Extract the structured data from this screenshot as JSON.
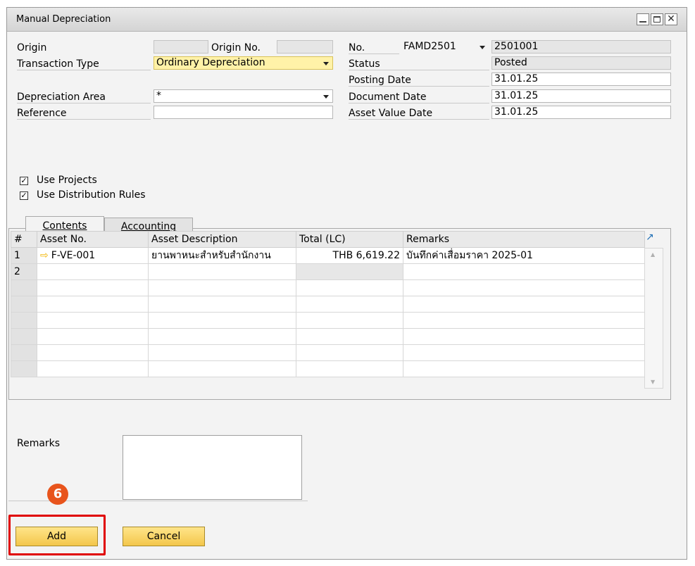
{
  "window": {
    "title": "Manual Depreciation",
    "min": "",
    "max": "",
    "close": "✕"
  },
  "header_left": {
    "origin_label": "Origin",
    "origin_value": "",
    "origin_no_label": "Origin No.",
    "origin_no_value": "",
    "transaction_type_label": "Transaction Type",
    "transaction_type_value": "Ordinary Depreciation",
    "depreciation_area_label": "Depreciation Area",
    "depreciation_area_value": "*",
    "reference_label": "Reference",
    "reference_value": ""
  },
  "header_right": {
    "no_label": "No.",
    "series_value": "FAMD2501",
    "no_value": "2501001",
    "status_label": "Status",
    "status_value": "Posted",
    "posting_date_label": "Posting Date",
    "posting_date_value": "31.01.25",
    "document_date_label": "Document Date",
    "document_date_value": "31.01.25",
    "asset_value_date_label": "Asset Value Date",
    "asset_value_date_value": "31.01.25"
  },
  "options": {
    "use_projects": "Use Projects",
    "use_distribution_rules": "Use Distribution Rules",
    "check_mark": "✓"
  },
  "tabs": [
    "Contents",
    "Accounting"
  ],
  "grid": {
    "columns": [
      "#",
      "Asset No.",
      "Asset Description",
      "Total (LC)",
      "Remarks"
    ],
    "rows": [
      {
        "n": "1",
        "asset_no": "F-VE-001",
        "description": "ยานพาหนะสำหรับสำนักงาน",
        "total": "THB 6,619.22",
        "remarks": "บันทึกค่าเสื่อมราคา 2025-01"
      },
      {
        "n": "2",
        "asset_no": "",
        "description": "",
        "total": "",
        "remarks": ""
      }
    ],
    "expand_glyph": "↗",
    "scroll_up": "▲",
    "scroll_down": "▼",
    "row_arrow": "⇨"
  },
  "footer": {
    "remarks_label": "Remarks",
    "remarks_value": "",
    "add_label": "Add",
    "cancel_label": "Cancel",
    "step_badge": "6"
  },
  "colors": {
    "accent_highlight": "#e00000",
    "badge": "#e8541c",
    "button": "#f3c64b",
    "field_yellow": "#fff2a8"
  }
}
